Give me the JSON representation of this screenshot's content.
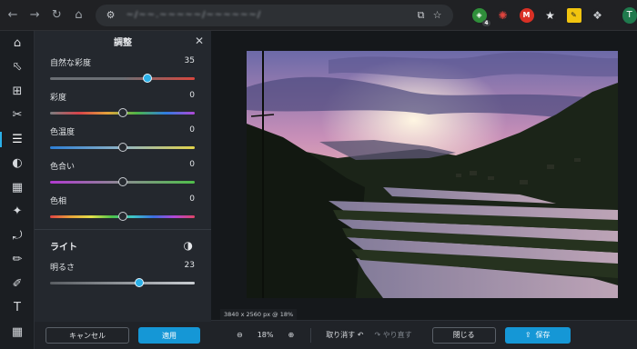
{
  "browser": {
    "url": "~/~~.~~~~~/~~~~~~/",
    "avatar_letter": "T",
    "badge_count": "4",
    "icons": [
      "back-icon",
      "forward-icon",
      "reload-icon",
      "home-icon",
      "site-settings-icon",
      "install-icon",
      "bookmark-star-icon",
      "extension-shield-icon",
      "pdf-icon",
      "extension-red-icon",
      "extension-star-icon",
      "extension-note-icon",
      "puzzle-icon"
    ]
  },
  "toolbar": {
    "items": [
      "home-icon",
      "select-icon",
      "crop-icon",
      "cut-icon",
      "adjust-icon",
      "filter-icon",
      "texture-icon",
      "effects-icon",
      "spiral-icon",
      "pencil-icon",
      "brush-icon",
      "text-icon",
      "pattern-icon"
    ]
  },
  "panel": {
    "title": "調整",
    "sliders": [
      {
        "label": "自然な彩度",
        "value": "35",
        "level": 0.675,
        "active": true
      },
      {
        "label": "彩度",
        "value": "0",
        "level": 0.5
      },
      {
        "label": "色温度",
        "value": "0",
        "level": 0.5
      },
      {
        "label": "色合い",
        "value": "0",
        "level": 0.5
      },
      {
        "label": "色相",
        "value": "0",
        "level": 0.5
      }
    ],
    "light": {
      "title": "ライト",
      "label": "明るさ",
      "value": "23",
      "level": 0.615
    },
    "cancel_label": "キャンセル",
    "apply_label": "適用"
  },
  "canvas": {
    "dimensions": "3840 x 2560 px @ 18%"
  },
  "bottom": {
    "zoom": "18%",
    "undo_label": "取り消す",
    "redo_label": "やり直す",
    "close_label": "閉じる",
    "save_label": "保存"
  },
  "colors": {
    "accent": "#1597d6",
    "panel_bg": "#24282e"
  }
}
